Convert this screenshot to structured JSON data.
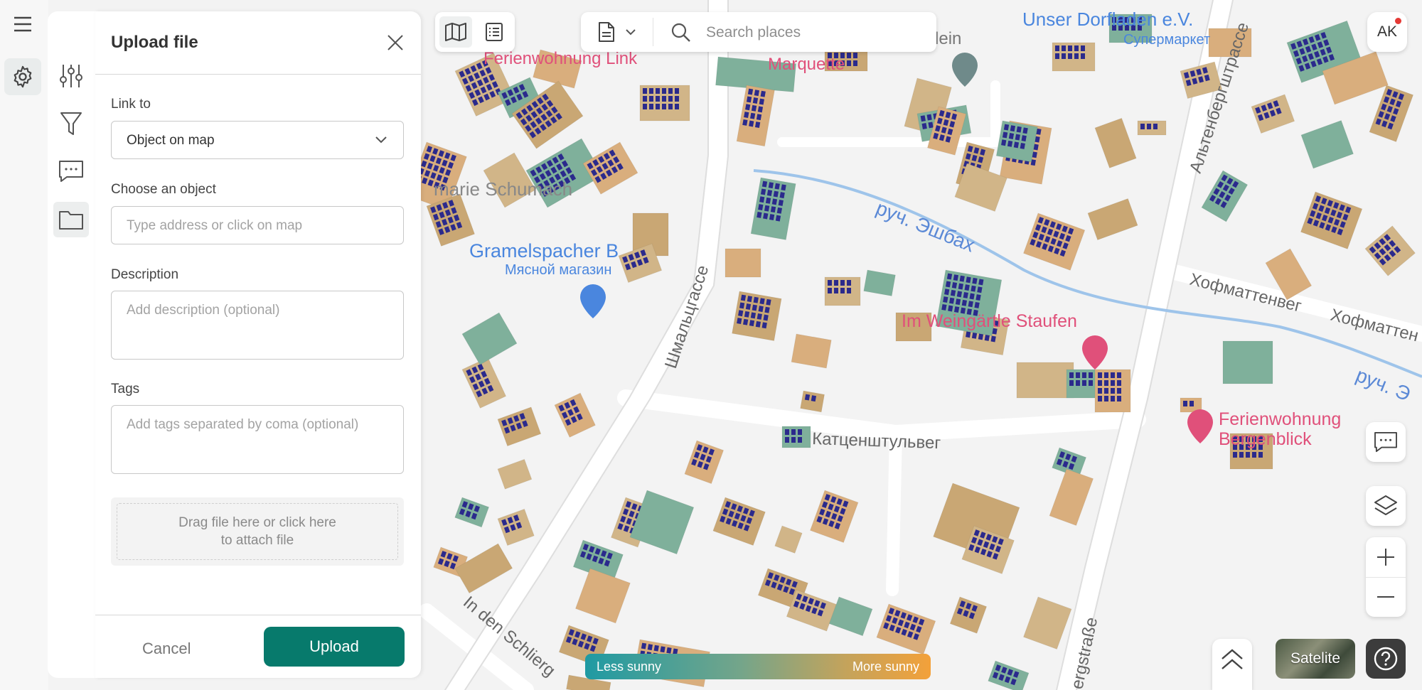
{
  "panel": {
    "title": "Upload file",
    "link_to": {
      "label": "Link to",
      "value": "Object on map"
    },
    "choose_object": {
      "label": "Choose an object",
      "placeholder": "Type address or click on map"
    },
    "description": {
      "label": "Description",
      "placeholder": "Add description (optional)"
    },
    "tags": {
      "label": "Tags",
      "placeholder": "Add tags separated by coma (optional)"
    },
    "dropzone": {
      "line1": "Drag file here or click here",
      "line2": "to attach file"
    },
    "cancel_label": "Cancel",
    "upload_label": "Upload"
  },
  "search": {
    "placeholder": "Search places"
  },
  "user": {
    "initials": "AK"
  },
  "legend": {
    "left": "Less sunny",
    "right": "More sunny"
  },
  "satellite_label": "Satelite",
  "map_labels": {
    "street_schmalzgasse": "Шмальцгассе",
    "street_katzen": "Катценштульвег",
    "street_hofmatten": "Хофматтенвег",
    "street_hofmatten2": "Хофматтен",
    "street_altenberg": "Альтенбергштрассе",
    "street_schlierg": "In den Schlierg",
    "street_bergstrasse": "ergstraße",
    "creek1": "руч. Эшбах",
    "creek2": "руч. Э",
    "poi_ferienwohnung_link": "Ferienwohnung Link",
    "poi_marquette": "Marquette",
    "poi_zeklein": "Zeklein",
    "poi_unser_dorfladen": "Unser Dorfladen e.V.",
    "poi_supermarket": "Супермаркет",
    "poi_marie_schumacher": "marie Schumach",
    "poi_gramelspacher": "Gramelspacher B",
    "poi_butcher": "Мясной магазин",
    "poi_im_weingarten": "Im Weingärtle Staufen",
    "poi_ferienwohnung_b1": "Ferienwohnung",
    "poi_ferienwohnung_b2": "Bergenblick"
  },
  "colors": {
    "accent": "#077a6c",
    "panel_bg": "#ffffff",
    "map_bg": "#f2f2f2",
    "solar": "#2b2a8c"
  },
  "icons": [
    "menu-icon",
    "settings-icon",
    "sliders-icon",
    "filter-icon",
    "comment-icon",
    "folder-icon",
    "close-icon",
    "chevron-down-icon",
    "map-icon",
    "list-icon",
    "document-icon",
    "search-icon",
    "comment-icon",
    "layers-icon",
    "plus-icon",
    "minus-icon",
    "chevron-up-icon",
    "help-icon"
  ]
}
